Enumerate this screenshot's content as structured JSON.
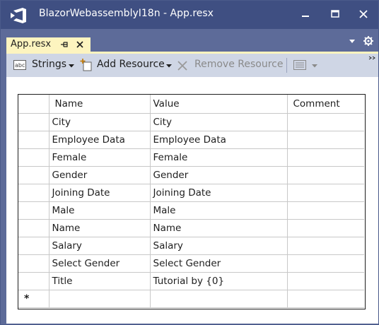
{
  "window": {
    "title": "BlazorWebassemblyI18n - App.resx",
    "icons": [
      "visual-studio-logo",
      "minimize-icon",
      "maximize-icon",
      "close-icon"
    ]
  },
  "tab": {
    "label": "App.resx",
    "icons": [
      "pin-icon",
      "tab-close-icon"
    ]
  },
  "toolbar": {
    "strings_label": "Strings",
    "add_resource_label": "Add Resource",
    "remove_resource_label": "Remove Resource",
    "icons": [
      "abc-icon",
      "add-resource-icon",
      "remove-x-icon",
      "view-icon",
      "chevron-down-icon"
    ]
  },
  "grid": {
    "columns": [
      "Name",
      "Value",
      "Comment"
    ],
    "rows": [
      {
        "name": "City",
        "value": "City",
        "comment": ""
      },
      {
        "name": "Employee Data",
        "value": "Employee Data",
        "comment": ""
      },
      {
        "name": "Female",
        "value": "Female",
        "comment": ""
      },
      {
        "name": "Gender",
        "value": "Gender",
        "comment": ""
      },
      {
        "name": "Joining Date",
        "value": "Joining Date",
        "comment": ""
      },
      {
        "name": "Male",
        "value": "Male",
        "comment": ""
      },
      {
        "name": "Name",
        "value": "Name",
        "comment": ""
      },
      {
        "name": "Salary",
        "value": "Salary",
        "comment": ""
      },
      {
        "name": "Select Gender",
        "value": "Select Gender",
        "comment": ""
      },
      {
        "name": "Title",
        "value": "Tutorial by {0}",
        "comment": ""
      }
    ],
    "new_row_marker": "*"
  },
  "colors": {
    "titlebar": "#3f4f82",
    "chrome": "#5d6b99",
    "active_tab": "#fdf4bf",
    "toolbar": "#cfd6e5",
    "vs_purple": "#68217a"
  }
}
